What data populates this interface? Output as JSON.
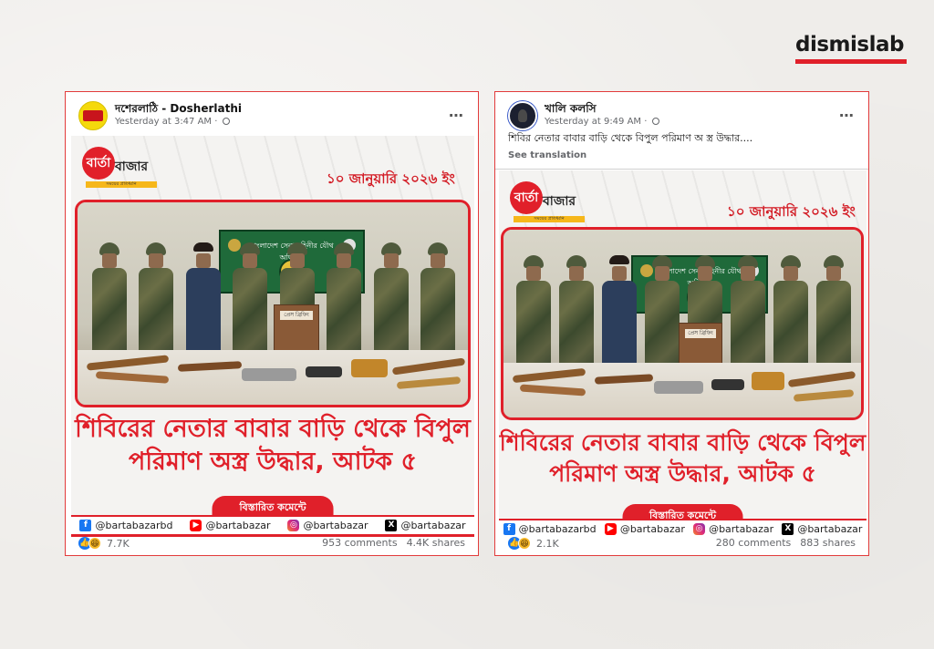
{
  "brand": {
    "logo": "dismislab",
    "accent": "#e0202a"
  },
  "posts": [
    {
      "page_name": "দশেরলাঠি - Dosherlathi",
      "time": "Yesterday at 3:47 AM · ",
      "caption": "",
      "see_translation": "",
      "graphic": {
        "logo_bubble": "বার্তা",
        "logo_name": "বাজার",
        "logo_tagline": "সময়ের প্রতিধ্বনি",
        "date": "১০ জানুয়ারি ২০২৬ ইং",
        "banner_text": "বাংলাদেশ সেনাবাহিনীর যৌথ অভিযান",
        "podium_text": "প্রেস ব্রিফিং",
        "headline_line1": "শিবিরের নেতার বাবার বাড়ি থেকে বিপুল",
        "headline_line2": "পরিমাণ অস্ত্র উদ্ধার, আটক ৫",
        "details": "বিস্তারিত কমেন্টে"
      },
      "socials": [
        "@bartabazarbd",
        "@bartabazar",
        "@bartabazar",
        "@bartabazar"
      ],
      "reactions": "7.7K",
      "comments": "953 comments",
      "shares": "4.4K shares"
    },
    {
      "page_name": "খালি কলসি",
      "time": "Yesterday at 9:49 AM · ",
      "caption": "শিবির নেতার বাবার বাড়ি থেকে বিপুল পরিমাণ অ স্ত্র  উদ্ধার....",
      "see_translation": "See translation",
      "graphic": {
        "logo_bubble": "বার্তা",
        "logo_name": "বাজার",
        "logo_tagline": "সময়ের প্রতিধ্বনি",
        "date": "১০ জানুয়ারি ২০২৬ ইং",
        "banner_text": "বাংলাদেশ সেনাবাহিনীর যৌথ অভিযান",
        "podium_text": "প্রেস ব্রিফিং",
        "headline_line1": "শিবিরের নেতার বাবার বাড়ি থেকে বিপুল",
        "headline_line2": "পরিমাণ অস্ত্র উদ্ধার, আটক ৫",
        "details": "বিস্তারিত কমেন্টে"
      },
      "socials": [
        "@bartabazarbd",
        "@bartabazar",
        "@bartabazar",
        "@bartabazar"
      ],
      "reactions": "2.1K",
      "comments": "280 comments",
      "shares": "883 shares"
    }
  ],
  "icons": {
    "more": "⋯",
    "facebook": "f",
    "youtube": "▶",
    "instagram": "◎",
    "x": "X",
    "like": "👍",
    "haha": "😆"
  }
}
